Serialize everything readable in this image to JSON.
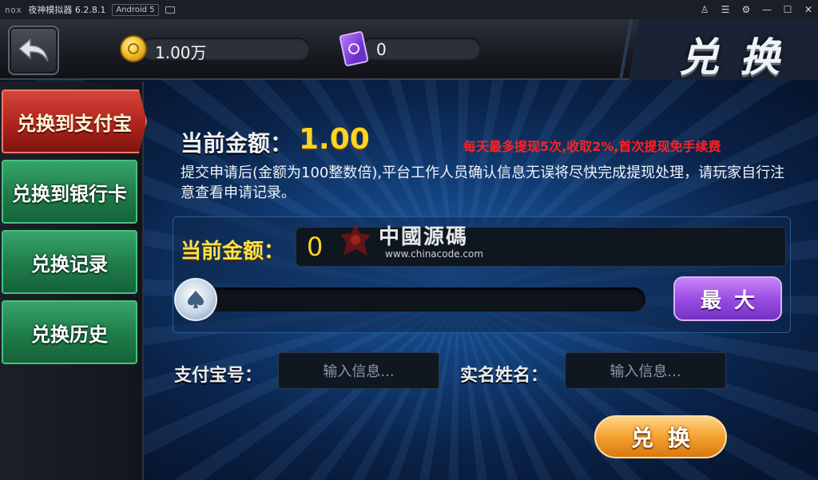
{
  "emulator": {
    "logo": "nox",
    "title": "夜神模拟器 6.2.8.1",
    "android_badge": "Android 5",
    "controls": [
      "shirt-icon",
      "menu-icon",
      "gear-icon",
      "minimize-icon",
      "maximize-icon",
      "close-icon"
    ]
  },
  "header": {
    "back_icon": "back-arrow-icon",
    "gold_amount": "1.00万",
    "card_amount": "0",
    "card_icon_label": "房卡",
    "title": "兑换"
  },
  "sidebar": {
    "items": [
      {
        "label": "兑换到支付宝",
        "active": true
      },
      {
        "label": "兑换到银行卡",
        "active": false
      },
      {
        "label": "兑换记录",
        "active": false
      },
      {
        "label": "兑换历史",
        "active": false
      }
    ]
  },
  "main": {
    "current_label": "当前金额：",
    "current_value": "1.00",
    "notice": "每天最多提现5次,收取2%,首次提现免手续费",
    "description": "提交申请后(金额为100整数倍),平台工作人员确认信息无误将尽快完成提现处理，请玩家自行注意查看申请记录。",
    "amount_label": "当前金额：",
    "amount_value": "0",
    "slider_fraction": 0,
    "max_button": "最大",
    "alipay_label": "支付宝号：",
    "alipay_placeholder": "输入信息...",
    "name_label": "实名姓名：",
    "name_placeholder": "输入信息...",
    "submit_button": "兑换"
  },
  "watermark": {
    "cn": "中國源碼",
    "url": "www.chinacode.com"
  },
  "colors": {
    "gold": "#ffd322",
    "notice_red": "#ff2222",
    "sidebar_active": "#a8211a",
    "sidebar_normal": "#1e7b49",
    "max_purple": "#9b4de3",
    "submit_orange": "#f7a535"
  }
}
